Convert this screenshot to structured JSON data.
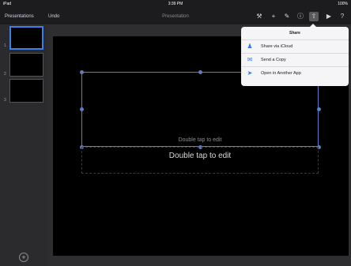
{
  "status_bar": {
    "carrier": "iPad",
    "time": "3:39 PM",
    "battery": "100%"
  },
  "toolbar": {
    "back_label": "Presentations",
    "undo_label": "Undo",
    "title": "Presentation",
    "icons": [
      "wrench-icon",
      "add-icon",
      "brush-icon",
      "share-icon",
      "play-icon",
      "help-icon"
    ]
  },
  "slides": {
    "numbers": [
      "1",
      "2",
      "3"
    ],
    "add_icon": "plus-icon"
  },
  "slide": {
    "title_placeholder": "Double tap to edit",
    "subtitle_placeholder": "Double tap to edit"
  },
  "share_popover": {
    "title": "Share",
    "items": [
      {
        "label": "Share via iCloud",
        "icon": "person-add-icon"
      },
      {
        "label": "Send a Copy",
        "icon": "mail-icon"
      },
      {
        "label": "Open in Another App",
        "icon": "share-arrow-icon"
      }
    ]
  },
  "colors": {
    "accent": "#3478f6",
    "toolbar": "#1c1c1e",
    "canvas": "#000000"
  }
}
